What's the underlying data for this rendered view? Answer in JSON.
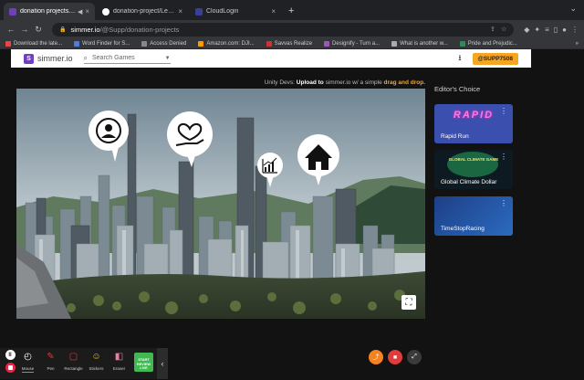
{
  "browser": {
    "tabs": [
      {
        "title": "donation projects | SIMMER",
        "active": true,
        "audio": true
      },
      {
        "title": "donation-project/Leaderboard",
        "active": false,
        "audio": false
      },
      {
        "title": "CloudLogin",
        "active": false,
        "audio": false
      }
    ],
    "new_tab": "+",
    "url_host": "simmer.io",
    "url_path": "/@Supp/donation-projects",
    "bookmarks": [
      "Download the late...",
      "Word Finder for S...",
      "Access Denied",
      "Amazon.com: DJI...",
      "Savvas Realize",
      "Designify - Turn a...",
      "What is another w...",
      "Pride and Prejudic..."
    ]
  },
  "site": {
    "logo_text": "simmer.io",
    "search_placeholder": "Search Games",
    "user_button": "@SUPP7508",
    "dev_prefix": "Unity Devs:",
    "dev_upload": "Upload to",
    "dev_mid": "simmer.io w/ a simple",
    "dev_highlight": "drag and drop.",
    "editors_choice": "Editor's Choice",
    "cards": [
      {
        "title_art": "RAPID",
        "label": "Rapid Run",
        "bg": "#3b4fae"
      },
      {
        "title_art": "GLOBAL CLIMATE GAME",
        "label": "Global Climate Dollar",
        "bg": "#0d1a22"
      },
      {
        "title_art": "",
        "label": "TimeStopRacing",
        "bg": "#1f4f9a"
      }
    ]
  },
  "game": {
    "bubbles": [
      "user-icon",
      "heart-hand-icon",
      "chart-icon",
      "home-icon"
    ]
  },
  "zoom": {
    "tools": [
      {
        "label": "Mouse",
        "icon": "cursor-icon",
        "active": true
      },
      {
        "label": "Pen",
        "icon": "pen-icon",
        "active": false
      },
      {
        "label": "Rectangle",
        "icon": "rectangle-icon",
        "active": false
      },
      {
        "label": "Stickers",
        "icon": "smiley-icon",
        "active": false
      },
      {
        "label": "Eraser",
        "icon": "eraser-icon",
        "active": false
      }
    ],
    "start_label": "START\nREVIEW LIVE"
  },
  "colors": {
    "accent": "#f6a623",
    "brand": "#6e3fbf",
    "share": "#f5821f",
    "record": "#e23b3b"
  }
}
